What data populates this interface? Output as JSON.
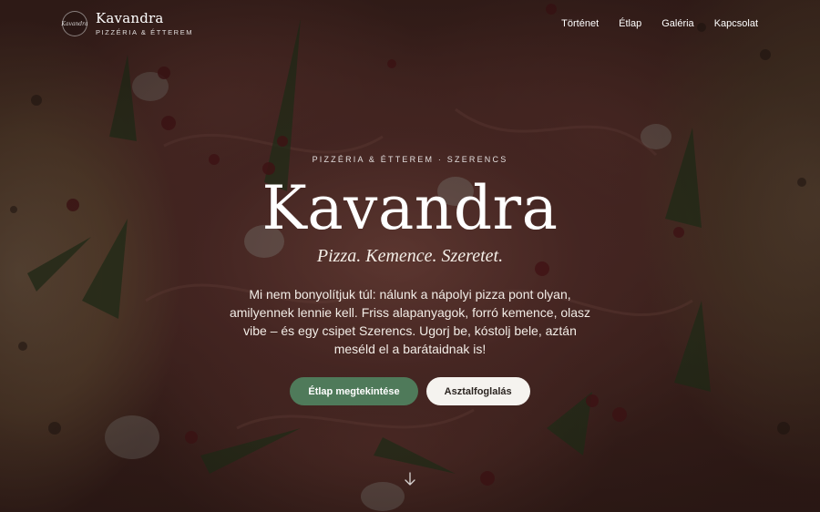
{
  "brand": {
    "logo_text": "Kavandra",
    "name": "Kavandra",
    "subtitle": "PIZZÉRIA & ÉTTEREM"
  },
  "nav": {
    "links": [
      "Történet",
      "Étlap",
      "Galéria",
      "Kapcsolat"
    ]
  },
  "hero": {
    "eyebrow": "PIZZÉRIA & ÉTTEREM · SZERENCS",
    "title": "Kavandra",
    "tagline": "Pizza. Kemence. Szeretet.",
    "lead": "Mi nem bonyolítjuk túl: nálunk a nápolyi pizza pont olyan, amilyennek lennie kell. Friss alapanyagok, forró kemence, olasz vibe – és egy csipet Szerencs. Ugorj be, kóstolj bele, aztán meséld el a barátaidnak is!",
    "primary_button": "Étlap megtekintése",
    "secondary_button": "Asztalfoglalás",
    "scroll_icon": "arrow-down-icon"
  },
  "colors": {
    "primary_button": "#4f7a5a",
    "secondary_button": "#f5f3ef",
    "text": "#ffffff"
  }
}
